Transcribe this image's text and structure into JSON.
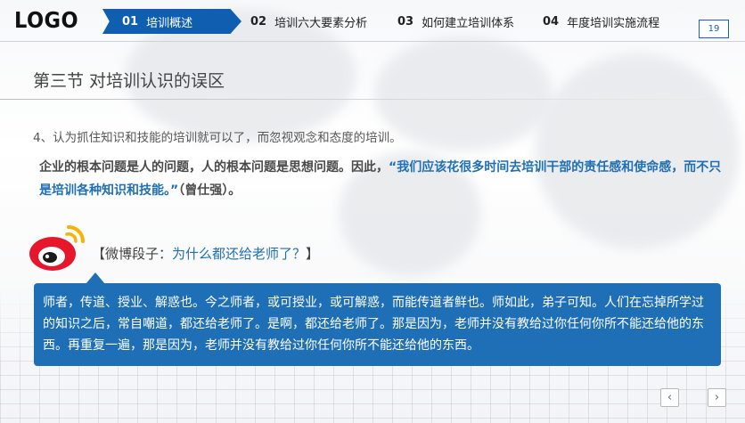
{
  "header": {
    "logo": "LOGO",
    "nav": [
      {
        "num": "01",
        "label": "培训概述"
      },
      {
        "num": "02",
        "label": "培训六大要素分析"
      },
      {
        "num": "03",
        "label": "如何建立培训体系"
      },
      {
        "num": "04",
        "label": "年度培训实施流程"
      }
    ],
    "page_number": "19"
  },
  "section_title": "第三节  对培训认识的误区",
  "point": "4、认为抓住知识和技能的培训就可以了，而忽视观念和态度的培训。",
  "quote": {
    "lead": "企业的根本问题是人的问题，人的根本问题是思想问题。因此，",
    "highlight": "“我们应该花很多时间去培训干部的责任感和使命感，而不只是培训各种知识和技能。”",
    "tail": "（曾仕强）。"
  },
  "weibo": {
    "bracket_open": "【微博段子：",
    "question": "为什么都还给老师了？",
    "bracket_close": "】"
  },
  "callout_text": "师者，传道、授业、解惑也。今之师者，或可授业，或可解惑，而能传道者鲜也。师如此，弟子可知。人们在忘掉所学过的知识之后，常自嘲道，都还给老师了。是啊，都还给老师了。那是因为，老师并没有教给过你任何你所不能还给他的东西。再重复一遍，那是因为，老师并没有教给过你任何你所不能还给他的东西。",
  "pager": {
    "prev": "‹",
    "next": "›"
  },
  "colors": {
    "accent": "#1f6fb6",
    "nav_active": "#0f5eb0",
    "weibo_red": "#e6162d",
    "weibo_yellow": "#f5b400"
  },
  "icons": {
    "brand": "weibo-icon",
    "prev": "chevron-left-icon",
    "next": "chevron-right-icon"
  }
}
